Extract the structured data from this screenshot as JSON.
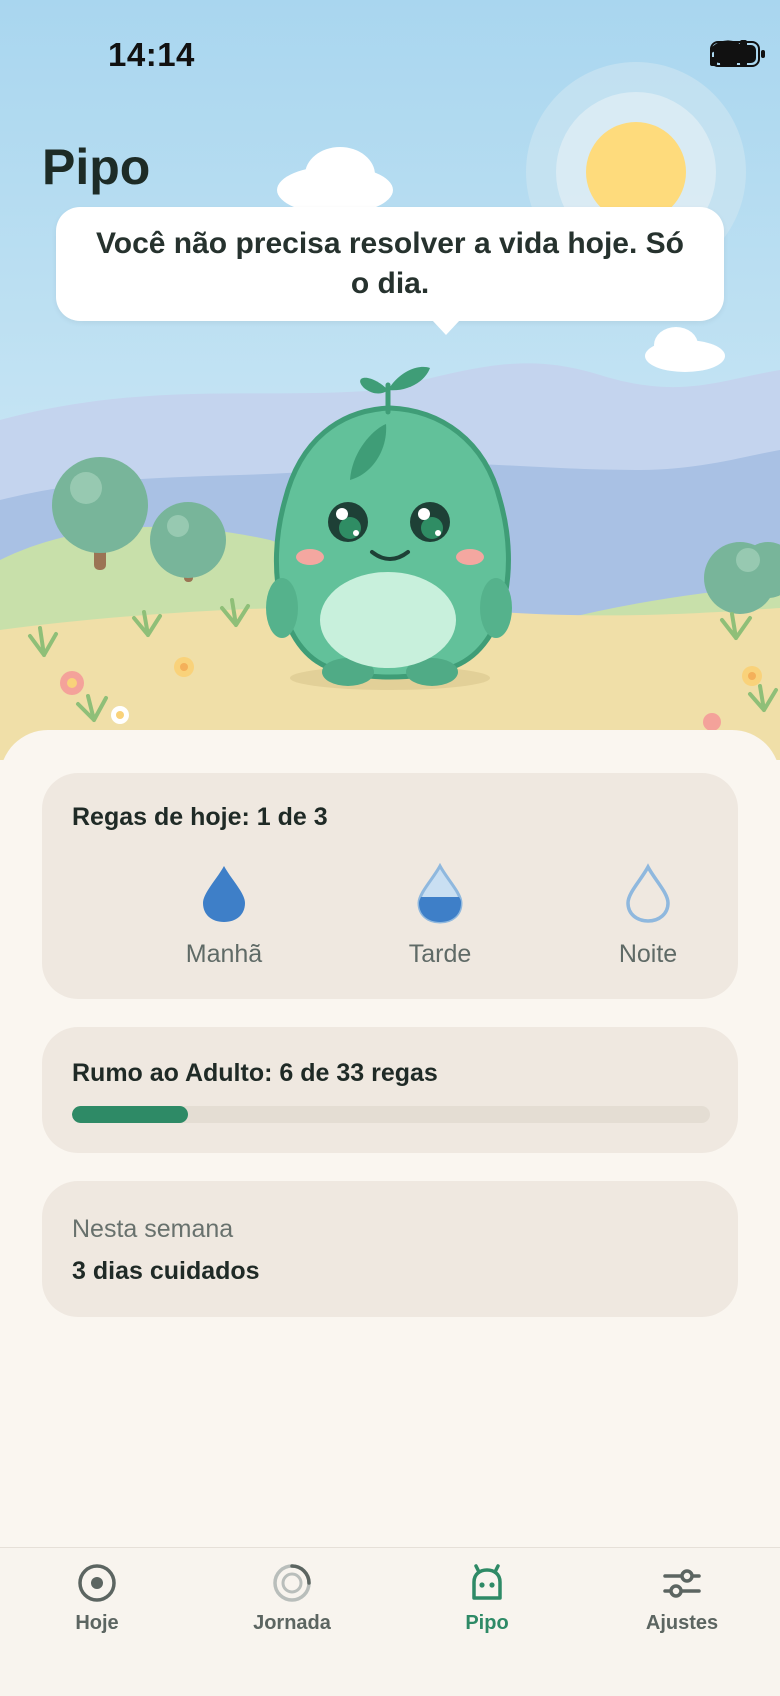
{
  "status_bar": {
    "time": "14:14"
  },
  "page_title": "Pipo",
  "speech_bubble": "Você não precisa resolver a vida hoje. Só o dia.",
  "watering": {
    "title": "Regas de hoje: 1 de 3",
    "slots": [
      {
        "label": "Manhã",
        "state": "full"
      },
      {
        "label": "Tarde",
        "state": "partial"
      },
      {
        "label": "Noite",
        "state": "empty"
      }
    ]
  },
  "progress": {
    "title": "Rumo ao Adulto: 6 de 33 regas",
    "current": 6,
    "total": 33
  },
  "week": {
    "label": "Nesta semana",
    "value": "3 dias cuidados"
  },
  "tabs": [
    {
      "label": "Hoje",
      "icon": "target-icon",
      "active": false
    },
    {
      "label": "Jornada",
      "icon": "progress-ring-icon",
      "active": false
    },
    {
      "label": "Pipo",
      "icon": "pet-icon",
      "active": true
    },
    {
      "label": "Ajustes",
      "icon": "sliders-icon",
      "active": false
    }
  ],
  "colors": {
    "accent": "#2e8a66",
    "water": "#3e7fc8",
    "card": "#efe8e0",
    "background": "#faf6f0"
  }
}
